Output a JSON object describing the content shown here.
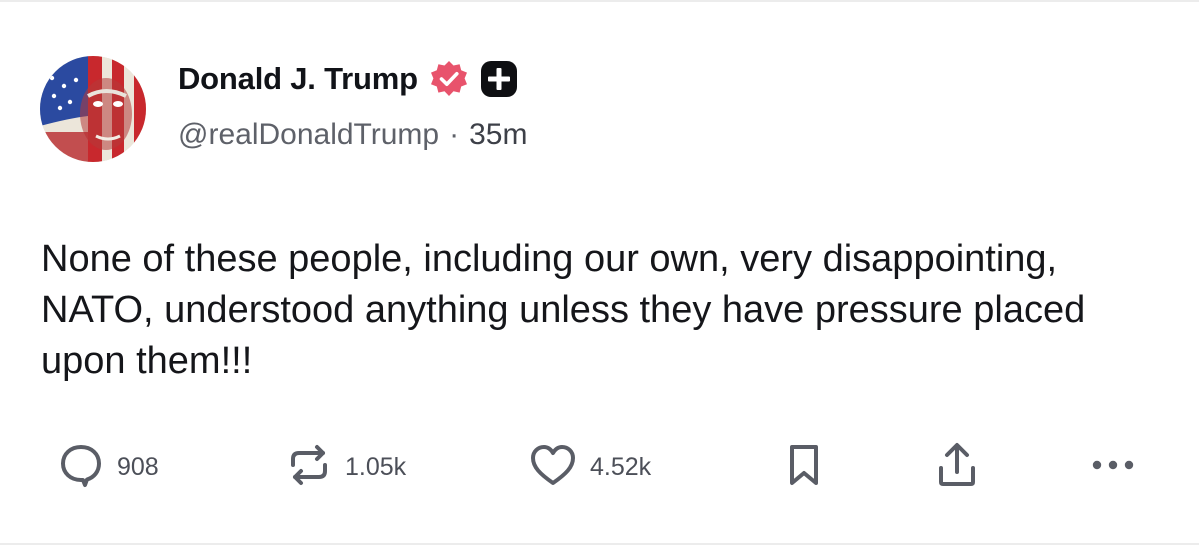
{
  "author": {
    "display_name": "Donald J. Trump",
    "handle": "@realDonaldTrump",
    "separator": "·",
    "time_ago": "35m",
    "verified_icon": "verified-check-icon",
    "plus_icon": "plus-badge-icon"
  },
  "post": {
    "text": "None of these people, including our own, very disappointing, NATO, understood anything unless they have pressure placed upon them!!!"
  },
  "actions": {
    "reply_count": "908",
    "repost_count": "1.05k",
    "like_count": "4.52k"
  },
  "colors": {
    "verified_badge": "#e8536c",
    "text_primary": "#15161a",
    "text_secondary": "#5e6169",
    "icon": "#5a5d66",
    "divider": "#ececec"
  }
}
